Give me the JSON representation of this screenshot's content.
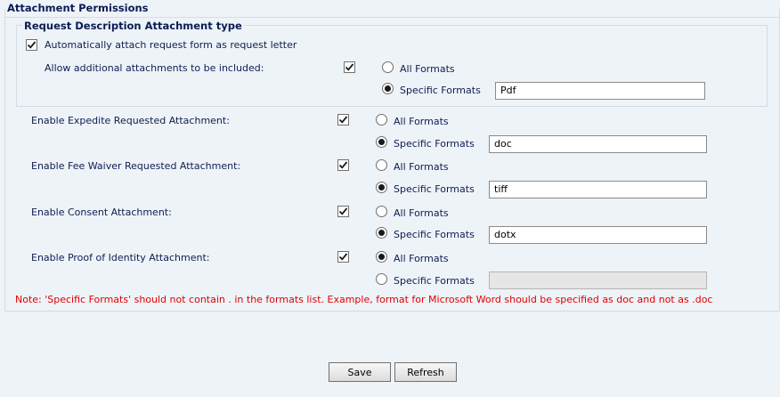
{
  "section_title": "Attachment Permissions",
  "subsection_title": "Request Description Attachment type",
  "auto_attach": {
    "label": "Automatically attach request form as request letter",
    "checked": true
  },
  "additional": {
    "label": "Allow additional attachments to be included:",
    "checked": true,
    "all_formats_label": "All Formats",
    "specific_formats_label": "Specific Formats",
    "selected": "specific",
    "formats_value": "Pdf"
  },
  "rows": [
    {
      "label": "Enable Expedite Requested Attachment:",
      "checked": true,
      "all_formats_label": "All Formats",
      "specific_formats_label": "Specific Formats",
      "selected": "specific",
      "formats_value": "doc",
      "enabled": true
    },
    {
      "label": "Enable Fee Waiver Requested Attachment:",
      "checked": true,
      "all_formats_label": "All Formats",
      "specific_formats_label": "Specific Formats",
      "selected": "specific",
      "formats_value": "tiff",
      "enabled": true
    },
    {
      "label": "Enable Consent Attachment:",
      "checked": true,
      "all_formats_label": "All Formats",
      "specific_formats_label": "Specific Formats",
      "selected": "specific",
      "formats_value": "dotx",
      "enabled": true
    },
    {
      "label": "Enable Proof of Identity Attachment:",
      "checked": true,
      "all_formats_label": "All Formats",
      "specific_formats_label": "Specific Formats",
      "selected": "all",
      "formats_value": "",
      "enabled": false
    }
  ],
  "note": "Note: 'Specific Formats' should not contain . in the formats list. Example, format for Microsoft Word should be specified as doc and not as .doc",
  "buttons": {
    "save": "Save",
    "refresh": "Refresh"
  },
  "colors": {
    "background": "#eef3f8",
    "heading": "#0b1c55",
    "note": "#e00000"
  }
}
